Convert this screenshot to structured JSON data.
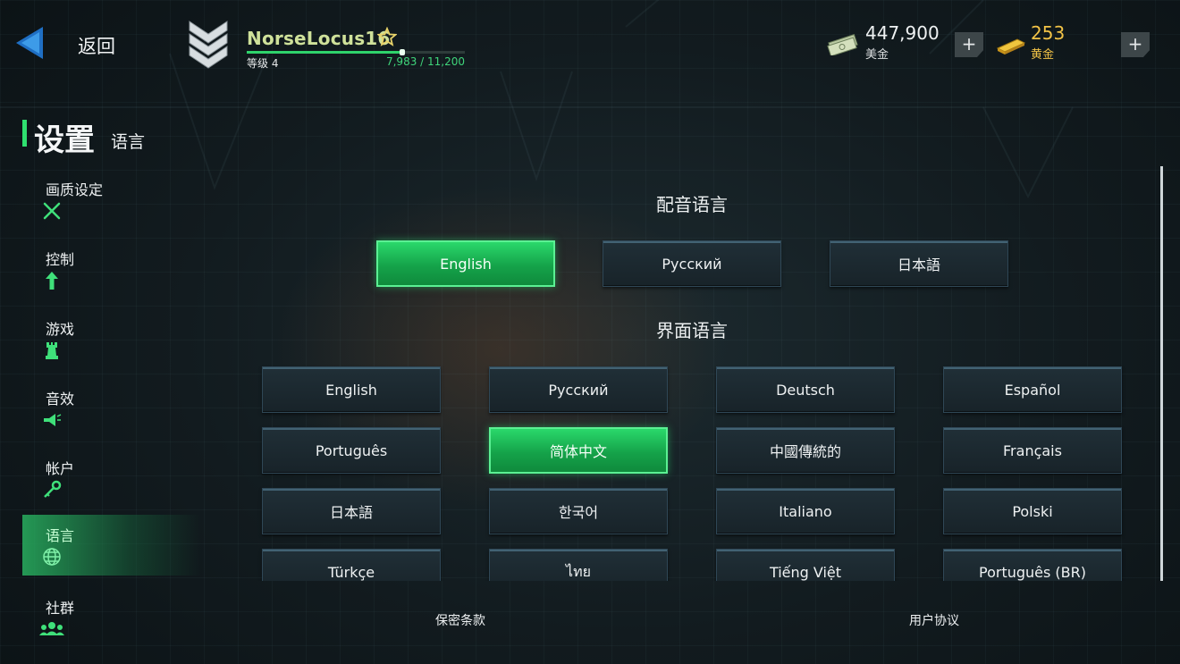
{
  "header": {
    "back_label": "返回",
    "player": {
      "name": "NorseLocus16",
      "level": "等级 4",
      "xp_text": "7,983 / 11,200",
      "xp_progress": 0.713
    },
    "currency": {
      "cash_amount": "447,900",
      "cash_label": "美金",
      "gold_amount": "253",
      "gold_label": "黄金",
      "plus_symbol": "+"
    }
  },
  "page": {
    "title": "设置",
    "subtitle": "语言"
  },
  "sidebar": {
    "items": [
      {
        "label": "画质设定",
        "icon": "wrench-screwdriver-icon"
      },
      {
        "label": "控制",
        "icon": "arrow-up-icon"
      },
      {
        "label": "游戏",
        "icon": "rook-icon"
      },
      {
        "label": "音效",
        "icon": "megaphone-icon"
      },
      {
        "label": "帐户",
        "icon": "key-icon"
      },
      {
        "label": "语言",
        "icon": "globe-icon",
        "active": true
      },
      {
        "label": "社群",
        "icon": "people-icon"
      }
    ]
  },
  "voice_section": {
    "title": "配音语言",
    "options": [
      "English",
      "Русский",
      "日本語"
    ],
    "selected": "English"
  },
  "ui_section": {
    "title": "界面语言",
    "options": [
      "English",
      "Русский",
      "Deutsch",
      "Español",
      "Português",
      "简体中文",
      "中國傳統的",
      "Français",
      "日本語",
      "한국어",
      "Italiano",
      "Polski",
      "Türkçe",
      "ไทย",
      "Tiếng Việt",
      "Português (BR)"
    ],
    "selected": "简体中文"
  },
  "footer": {
    "privacy": "保密条款",
    "agreement": "用户协议"
  },
  "colors": {
    "accent_green": "#2fe06f",
    "gold": "#f2c347",
    "name": "#cfe19a"
  }
}
